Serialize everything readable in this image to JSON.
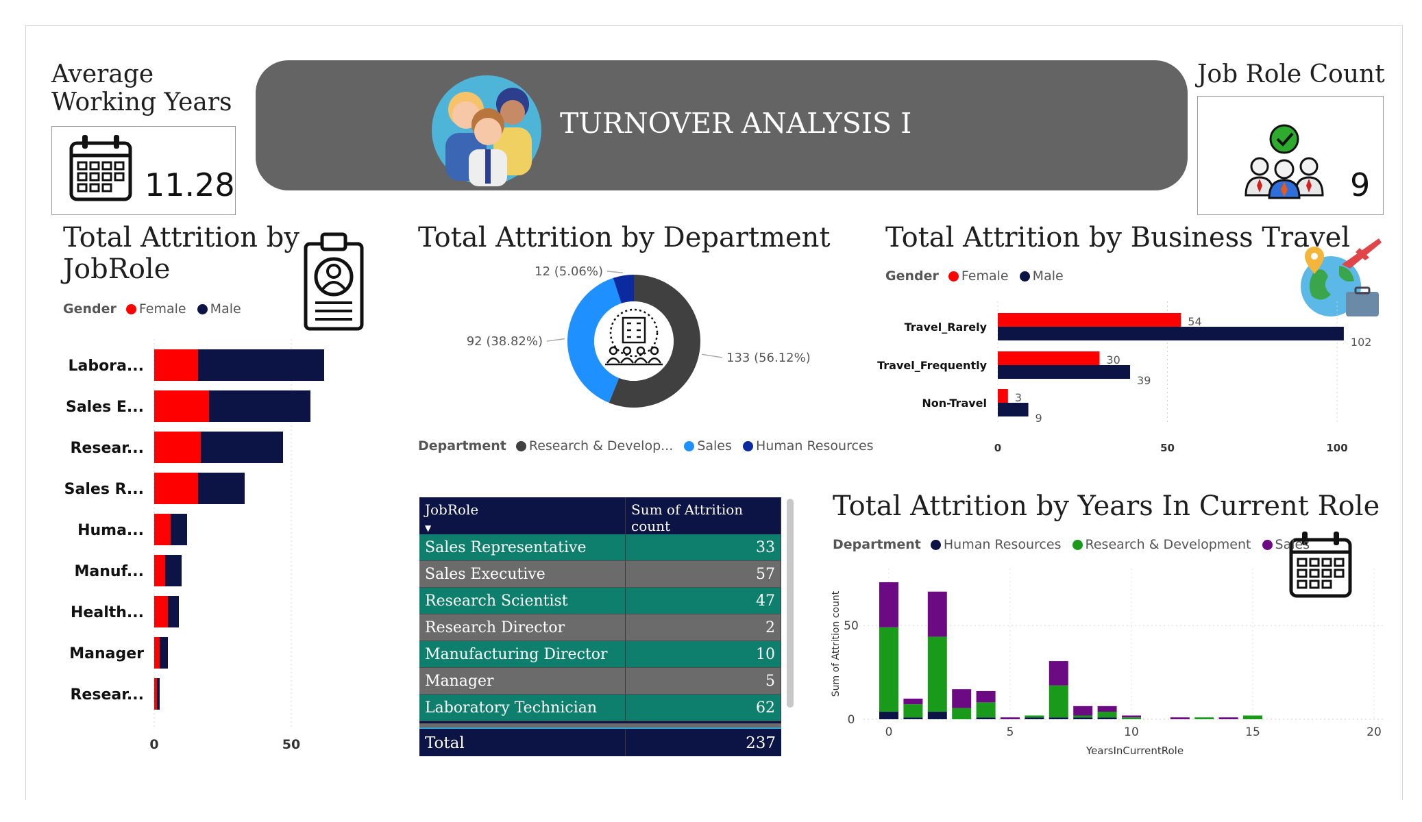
{
  "banner": {
    "title": "TURNOVER ANALYSIS I"
  },
  "kpi_avg_years": {
    "title_line1": "Average",
    "title_line2": "Working Years",
    "value": "11.28"
  },
  "kpi_job_roles": {
    "title": "Job Role Count",
    "value": "9"
  },
  "colors": {
    "female": "#ff0000",
    "male": "#0c1445",
    "research": "#404040",
    "sales_blue": "#1e90ff",
    "hr_navy": "#0c2aa0",
    "banner": "#646464",
    "teal": "#0e7e6d",
    "green": "#1a9a1a",
    "purple": "#6c0a84"
  },
  "icons": [
    "calendar-icon",
    "team-people-icon",
    "people-check-icon",
    "id-badge-icon",
    "building-people-icon",
    "globe-plane-icon",
    "calendar-icon"
  ],
  "legends": {
    "gender": {
      "label": "Gender",
      "female": "Female",
      "male": "Male"
    },
    "department_donut": {
      "label": "Department",
      "items": [
        "Research & Develop...",
        "Sales",
        "Human Resources"
      ]
    },
    "department_years": {
      "label": "Department",
      "items": [
        "Human Resources",
        "Research & Development",
        "Sales"
      ]
    }
  },
  "table": {
    "headers": [
      "JobRole",
      "Sum of Attrition count"
    ],
    "rows": [
      {
        "role": "Sales Representative",
        "value": "33"
      },
      {
        "role": "Sales Executive",
        "value": "57"
      },
      {
        "role": "Research Scientist",
        "value": "47"
      },
      {
        "role": "Research Director",
        "value": "2"
      },
      {
        "role": "Manufacturing Director",
        "value": "10"
      },
      {
        "role": "Manager",
        "value": "5"
      },
      {
        "role": "Laboratory Technician",
        "value": "62"
      }
    ],
    "total_label": "Total",
    "total_value": "237"
  },
  "chart_data": [
    {
      "id": "jobrole",
      "type": "bar",
      "orientation": "horizontal",
      "stacked": true,
      "title": "Total Attrition by JobRole",
      "categories": [
        "Labora...",
        "Sales E...",
        "Resear...",
        "Sales R...",
        "Huma...",
        "Manuf...",
        "Health...",
        "Manager",
        "Resear..."
      ],
      "series": [
        {
          "name": "Female",
          "values": [
            16,
            20,
            17,
            16,
            6,
            4,
            5,
            2,
            1
          ]
        },
        {
          "name": "Male",
          "values": [
            46,
            37,
            30,
            17,
            6,
            6,
            4,
            3,
            1
          ]
        }
      ],
      "xlim": [
        0,
        70
      ],
      "xticks": [
        0,
        50
      ],
      "legend_position": "top-left"
    },
    {
      "id": "department",
      "type": "pie",
      "donut": true,
      "title": "Total Attrition by Department",
      "categories": [
        "Research & Develop...",
        "Sales",
        "Human Resources"
      ],
      "values": [
        133,
        92,
        12
      ],
      "labels": [
        "133 (56.12%)",
        "92 (38.82%)",
        "12 (5.06%)"
      ],
      "legend_position": "bottom"
    },
    {
      "id": "travel",
      "type": "bar",
      "orientation": "horizontal",
      "stacked": false,
      "title": "Total Attrition by Business Travel",
      "categories": [
        "Travel_Rarely",
        "Travel_Frequently",
        "Non-Travel"
      ],
      "series": [
        {
          "name": "Female",
          "values": [
            54,
            30,
            3
          ]
        },
        {
          "name": "Male",
          "values": [
            102,
            39,
            9
          ]
        }
      ],
      "xlim": [
        0,
        110
      ],
      "xticks": [
        0,
        50,
        100
      ],
      "grid": true,
      "legend_position": "top-left"
    },
    {
      "id": "years",
      "type": "bar",
      "stacked": true,
      "title": "Total Attrition by Years In Current Role",
      "xlabel": "YearsInCurrentRole",
      "ylabel": "Sum of Attrition count",
      "x": [
        0,
        1,
        2,
        3,
        4,
        5,
        6,
        7,
        8,
        9,
        10,
        12,
        13,
        14,
        15
      ],
      "series": [
        {
          "name": "Human Resources",
          "values": [
            4,
            1,
            4,
            0,
            1,
            0,
            1,
            1,
            1,
            1,
            0,
            0,
            0,
            0,
            0
          ]
        },
        {
          "name": "Research & Development",
          "values": [
            45,
            7,
            40,
            6,
            8,
            0,
            1,
            17,
            1,
            3,
            1,
            0,
            1,
            0,
            2
          ]
        },
        {
          "name": "Sales",
          "values": [
            24,
            3,
            24,
            10,
            6,
            1,
            0,
            13,
            5,
            3,
            1,
            1,
            0,
            1,
            0
          ]
        }
      ],
      "xlim": [
        -0.5,
        20
      ],
      "ylim": [
        0,
        75
      ],
      "xticks": [
        0,
        5,
        10,
        15,
        20
      ],
      "yticks": [
        0,
        50
      ],
      "grid": true,
      "legend_position": "top-left"
    }
  ]
}
